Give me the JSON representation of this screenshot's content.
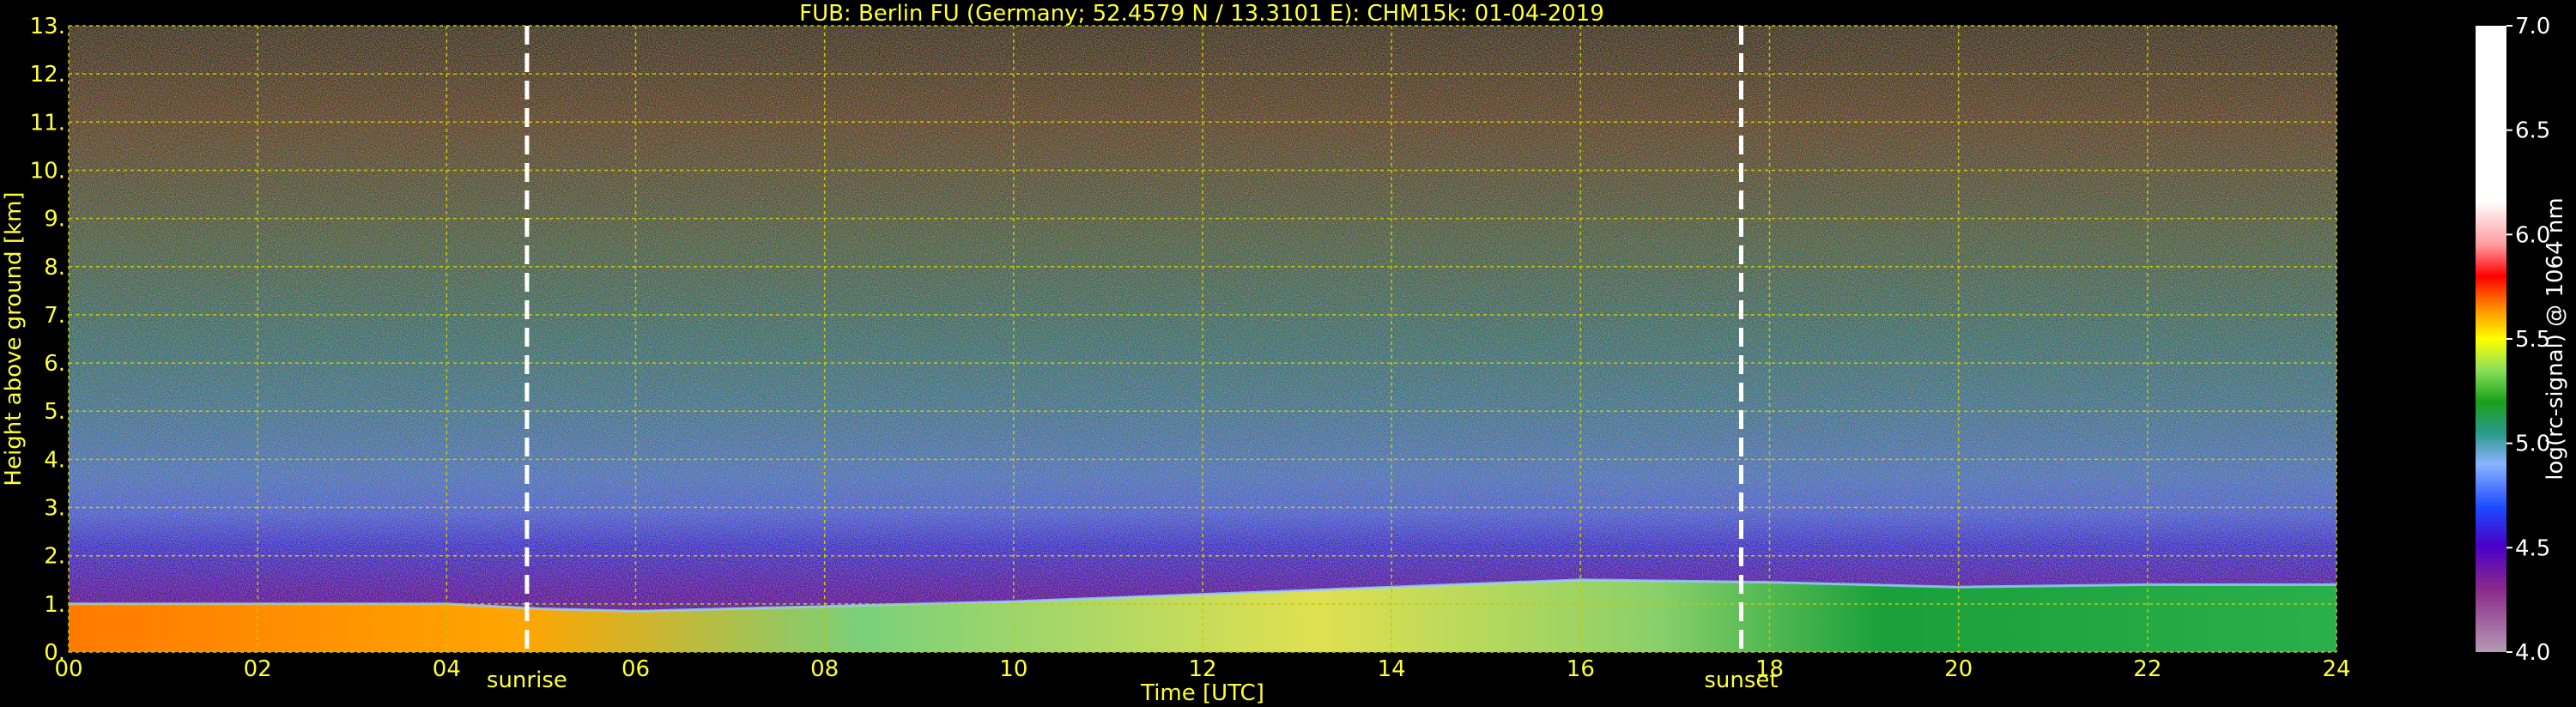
{
  "chart_data": {
    "type": "heatmap",
    "title": "FUB: Berlin FU (Germany; 52.4579 N / 13.3101 E):    CHM15k: 01-04-2019",
    "xlabel": "Time [UTC]",
    "ylabel": "Height above ground [km]",
    "xlim": [
      0,
      24
    ],
    "ylim": [
      0,
      13
    ],
    "x_ticks": [
      "00",
      "02",
      "04",
      "06",
      "08",
      "10",
      "12",
      "14",
      "16",
      "18",
      "20",
      "22",
      "24"
    ],
    "y_ticks": [
      "0.",
      "1.",
      "2.",
      "3.",
      "4.",
      "5.",
      "6.",
      "7.",
      "8.",
      "9.",
      "10.",
      "11.",
      "12.",
      "13."
    ],
    "grid": true,
    "events": [
      {
        "label": "sunrise",
        "time": 4.85
      },
      {
        "label": "sunset",
        "time": 17.7
      }
    ],
    "layer_top_km": [
      [
        0,
        1.0
      ],
      [
        2,
        1.0
      ],
      [
        4,
        1.0
      ],
      [
        5,
        0.9
      ],
      [
        6,
        0.85
      ],
      [
        8,
        0.95
      ],
      [
        10,
        1.05
      ],
      [
        12,
        1.2
      ],
      [
        14,
        1.35
      ],
      [
        16,
        1.5
      ],
      [
        18,
        1.45
      ],
      [
        20,
        1.35
      ],
      [
        22,
        1.4
      ],
      [
        24,
        1.4
      ]
    ],
    "colorbar": {
      "label": "log(rc-signal) @ 1064 nm",
      "range": [
        4.0,
        7.0
      ],
      "ticks": [
        "4.0",
        "4.5",
        "5.0",
        "5.5",
        "6.0",
        "6.5",
        "7.0"
      ]
    },
    "colors": {
      "text": "#ffff33",
      "grid": "#c8c800",
      "event_line": "#ffffff",
      "background": "#000000"
    }
  }
}
